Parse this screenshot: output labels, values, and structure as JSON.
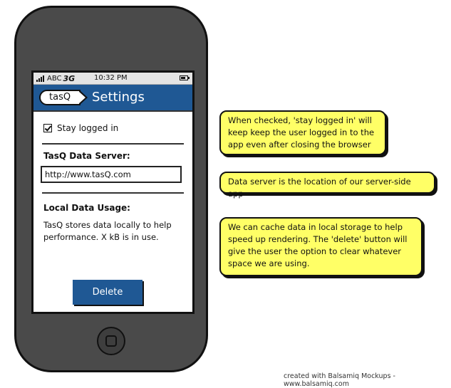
{
  "status_bar": {
    "carrier": "ABC",
    "network": "3G",
    "time": "10:32 PM"
  },
  "navbar": {
    "back_label": "tasQ",
    "title": "Settings"
  },
  "settings": {
    "stay_logged_in_label": "Stay logged in",
    "stay_logged_in_checked": true,
    "data_server_label": "TasQ Data Server:",
    "data_server_value": "http://www.tasQ.com",
    "local_usage_label": "Local Data Usage:",
    "local_usage_description": "TasQ stores data locally to help performance.  X kB is in use.",
    "delete_label": "Delete"
  },
  "notes": [
    "When checked, 'stay logged in' will keep keep the user logged in to the app even after closing the browser",
    "Data server is the location of our server-side app",
    "We can cache data in local storage to help speed up rendering.  The 'delete' button will give the user the option to clear whatever space we are using."
  ],
  "footer": "created with Balsamiq Mockups - www.balsamiq.com",
  "colors": {
    "accent_blue": "#1f5894",
    "note_yellow": "#ffff66",
    "phone_body": "#4a4a4a"
  }
}
